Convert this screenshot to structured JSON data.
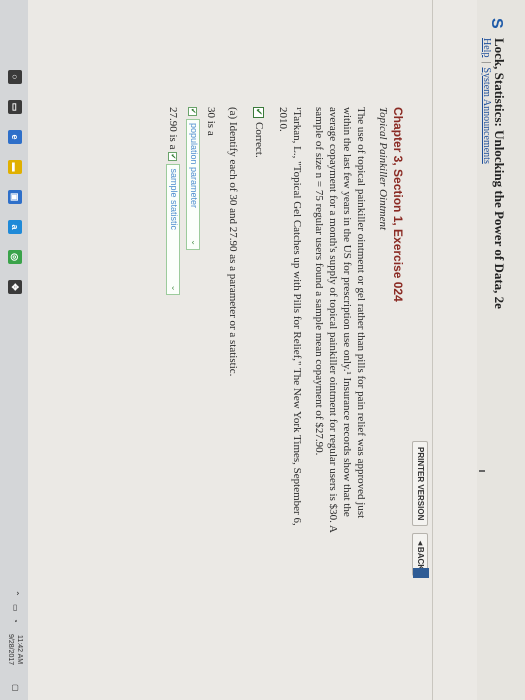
{
  "header": {
    "title": "Lock, Statistics: Unlocking the Power of Data, 2e",
    "help": "Help",
    "separator": "|",
    "announcements": "System Announcements"
  },
  "toolbar": {
    "printer_version": "PRINTER VERSION",
    "back": "◄BACK"
  },
  "content": {
    "chapter_title": "Chapter 3, Section 1, Exercise 024",
    "chapter_subtitle": "Topical Painkiller Ointment",
    "paragraph": "The use of topical painkiller ointment or gel rather than pills for pain relief was approved just within the last few years in the US for prescription use only.¹ Insurance records show that the average copayment for a month's supply of topical painkiller ointment for regular users is $30. A sample of size n = 75 regular users found a sample mean copayment of $27.90.",
    "citation": "¹Tarkan, L., \"Topical Gel Catches up with Pills for Relief,\" The New York Times, September 6, 2010.",
    "correct": "Correct.",
    "question": "(a) Identify each of 30 and 27.90 as a parameter or a statistic.",
    "line1_prefix": "30 is a",
    "select1_value": "population parameter",
    "line2_prefix": "27.90 is a",
    "select2_value": "sample statistic"
  },
  "taskbar": {
    "time": "11:42 AM",
    "date": "9/28/2017"
  }
}
